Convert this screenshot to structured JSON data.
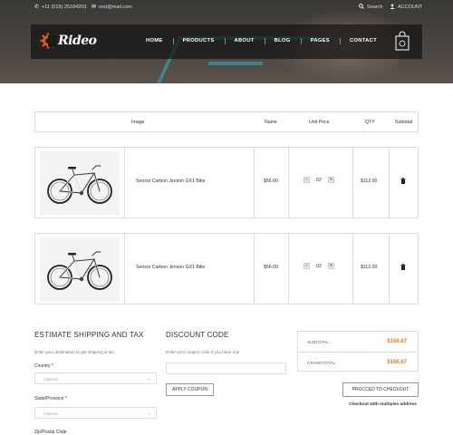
{
  "topbar": {
    "phone": "+11 (019) 25184203",
    "email": "rest@mail.com",
    "search_label": "Search",
    "account_label": "ACCOUNT"
  },
  "brand": {
    "logo_text": "Rideo"
  },
  "nav": {
    "items": [
      "HOME",
      "PRODUCTS",
      "ABOUT",
      "BLOG",
      "PAGES",
      "CONTACT"
    ]
  },
  "cart": {
    "columns": [
      "Image",
      "Name",
      "Unit Price",
      "QTY",
      "Subtotal"
    ],
    "rows": [
      {
        "name": "Sensor Carbon Jenson GX1 Bike",
        "unit_price": "$56.00",
        "qty": "02",
        "subtotal": "$112.00"
      },
      {
        "name": "Sensor Carbon Jenson GX1 Bike",
        "unit_price": "$56.00",
        "qty": "02",
        "subtotal": "$112.00"
      }
    ],
    "minus_label": "−",
    "plus_label": "+"
  },
  "shipping": {
    "title": "ESTIMATE SHIPPING AND TAX",
    "description": "Enter your destination to get shipping & tax",
    "country_label": "Country",
    "country_value": "Options",
    "state_label": "State/Province",
    "state_value": "Options",
    "zip_label": "Zip/Postal Code",
    "required_mark": "*"
  },
  "discount": {
    "title": "DISCOUNT CODE",
    "description": "Enter your coupon code if you have one",
    "input_value": "",
    "apply_label": "APPLY COUPON"
  },
  "totals": {
    "subtotal_label": "SUBTOTAL:",
    "subtotal_value": "$156.87",
    "grand_label": "GRANDTOTAL:",
    "grand_value": "$156.87",
    "checkout_label": "PROCCED TO CHECKOUT",
    "multi_note": "Checkout with multiples address"
  },
  "colors": {
    "accent": "#e67e22",
    "logo_gear": "#e0561f",
    "nav_bg": "#1a1a1a"
  },
  "icons": {
    "phone": "phone-icon",
    "mail": "mail-icon",
    "search": "search-icon",
    "account": "user-icon",
    "cart": "shopping-bag-icon",
    "delete": "trash-icon"
  }
}
